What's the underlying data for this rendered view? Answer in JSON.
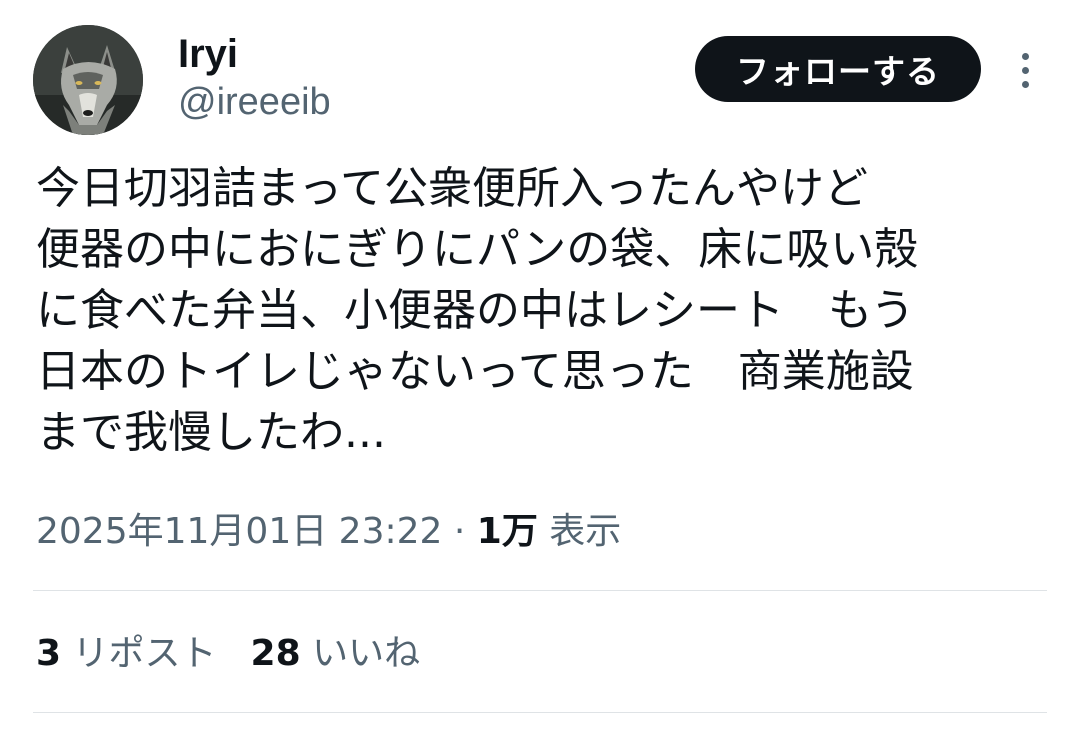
{
  "author": {
    "display_name": "Iryi",
    "handle": "@ireeeib"
  },
  "follow_label": "フォローする",
  "more_icon": "vertical-dots-icon",
  "avatar_icon": "wolf-avatar",
  "tweet_lines": [
    "今日切羽詰まって公衆便所入ったんやけど",
    "便器の中におにぎりにパンの袋、床に吸い殻",
    "に食べた弁当、小便器の中はレシート　もう",
    "日本のトイレじゃないって思った　商業施設",
    "まで我慢したわ..."
  ],
  "meta": {
    "timestamp": "2025年11月01日 23:22",
    "separator": " · ",
    "views_count": "1万",
    "views_label": " 表示"
  },
  "stats": {
    "reposts_count": "3",
    "reposts_label": " リポスト",
    "likes_count": "28",
    "likes_label": " いいね"
  },
  "colors": {
    "text_primary": "#0f1419",
    "text_secondary": "#536471",
    "button_bg": "#0f1419",
    "divider": "#dfe3e6"
  }
}
